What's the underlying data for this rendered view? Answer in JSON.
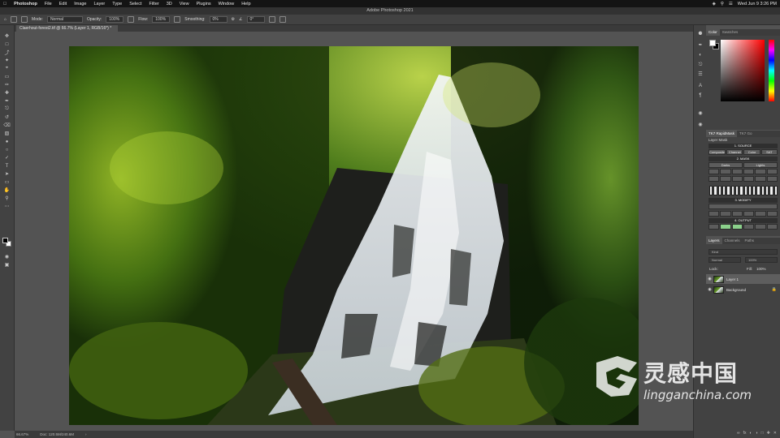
{
  "menubar": {
    "apple_icon": "apple-icon",
    "app_name": "Photoshop",
    "items": [
      "File",
      "Edit",
      "Image",
      "Layer",
      "Type",
      "Select",
      "Filter",
      "3D",
      "View",
      "Plugins",
      "Window",
      "Help"
    ],
    "clock": "Wed Jun 9  3:26 PM"
  },
  "window": {
    "title": "Adobe Photoshop 2021"
  },
  "options": {
    "mode_label": "Mode:",
    "mode_value": "Normal",
    "opacity_label": "Opacity:",
    "opacity_value": "100%",
    "flow_label": "Flow:",
    "flow_value": "100%",
    "smoothing_label": "Smoothing:",
    "smoothing_value": "0%",
    "angle_value": "0°"
  },
  "document": {
    "tab_title": "Claerhout-forest2.tif @ 66.7% (Layer 1, RGB/16*) *",
    "zoom": "66.67%",
    "doc_info": "Doc: 120.5M/240.6M"
  },
  "panels": {
    "color": {
      "tabs": [
        "Color",
        "Swatches"
      ],
      "fg": "#ffffff",
      "bg": "#000000"
    },
    "raya": {
      "tabs": [
        "TK7 RapidMask",
        "TK7 Go"
      ],
      "layer_mask_label": "Layer Mask",
      "sections": [
        "1. SOURCE",
        "2. MASK",
        "3. MODIFY",
        "4. OUTPUT"
      ],
      "source_buttons": [
        "Composite",
        "Channel",
        "Color",
        "SAT"
      ],
      "mask_buttons": [
        "Darks",
        "Lights"
      ],
      "output_highlight": "#8bd08b"
    },
    "layers": {
      "tabs": [
        "Layers",
        "Channels",
        "Paths"
      ],
      "filter_kind": "Kind",
      "blend_mode": "Normal",
      "opacity_label": "Opacity:",
      "opacity_value": "100%",
      "lock_label": "Lock:",
      "fill_label": "Fill:",
      "fill_value": "100%",
      "items": [
        {
          "name": "Layer 1",
          "selected": true
        },
        {
          "name": "Background",
          "selected": false,
          "locked": true
        }
      ]
    }
  },
  "watermark": {
    "cn": "灵感中国",
    "en": "lingganchina.com"
  }
}
